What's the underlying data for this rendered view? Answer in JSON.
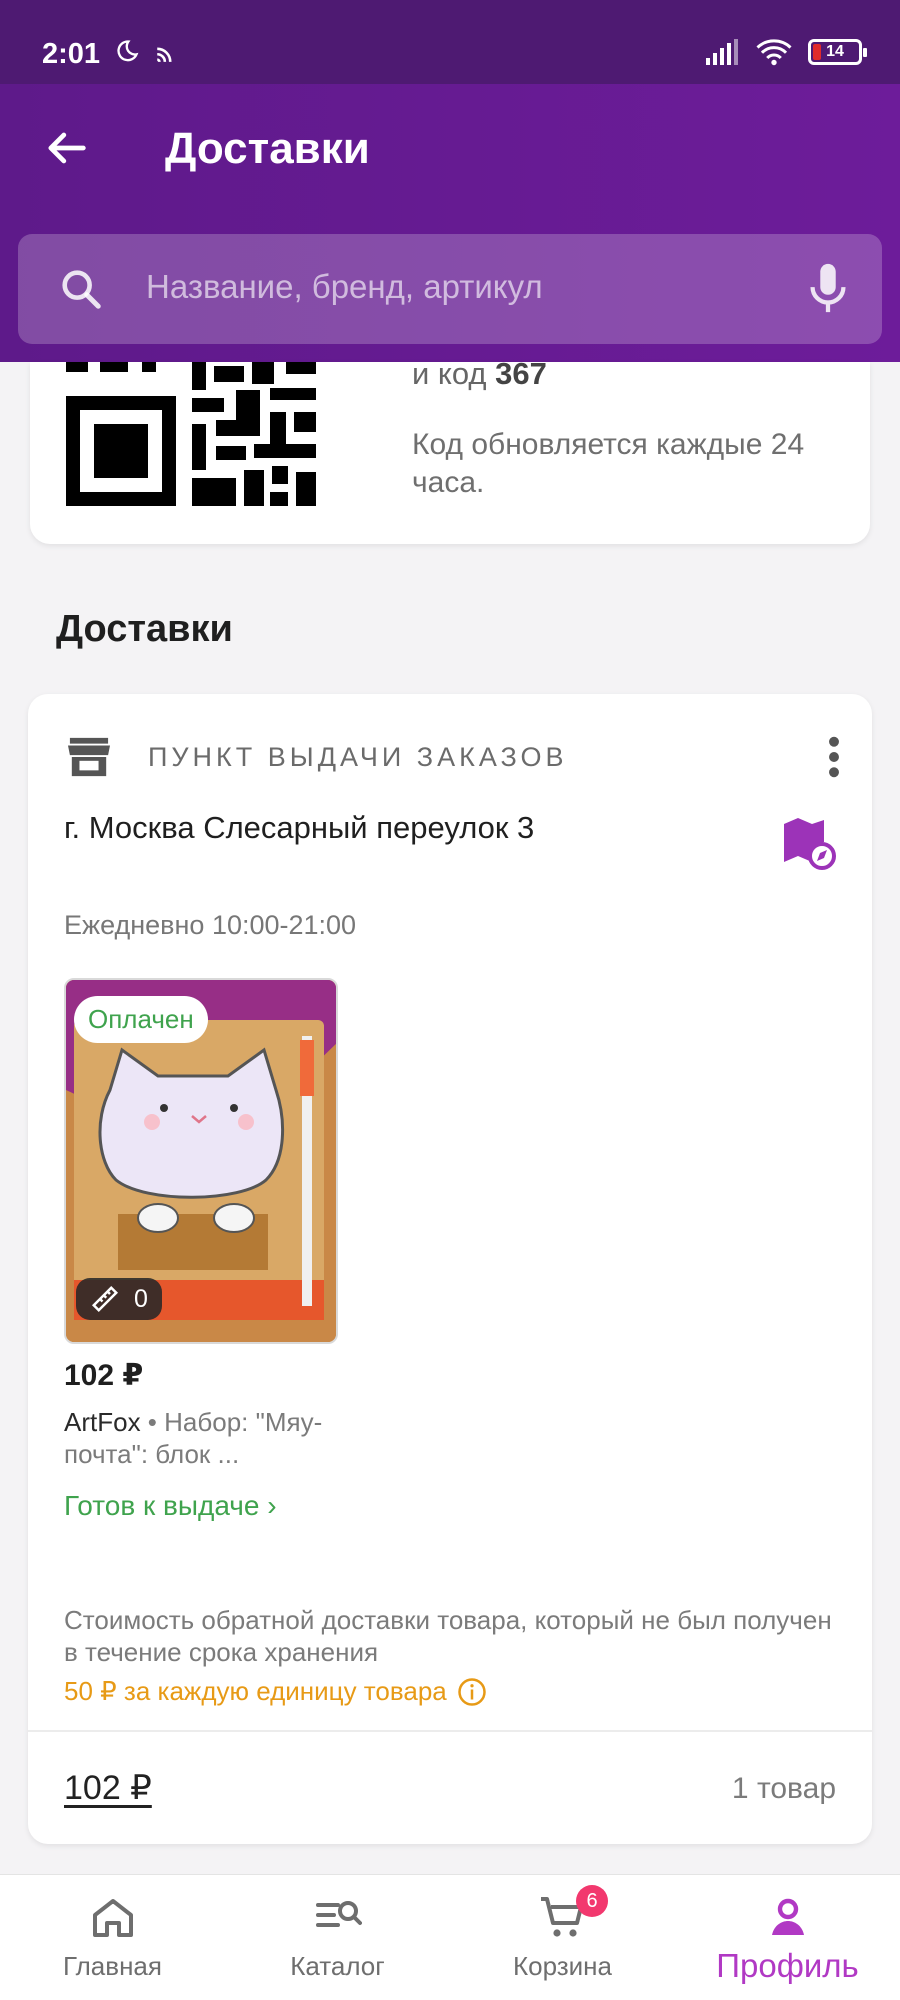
{
  "status_bar": {
    "time": "2:01",
    "battery": "14"
  },
  "header": {
    "title": "Доставки",
    "search_placeholder": "Название, бренд, артикул"
  },
  "qr_card": {
    "code_prefix": "и код",
    "code": "367",
    "refresh_note": "Код обновляется каждые 24 часа."
  },
  "section": {
    "title": "Доставки"
  },
  "delivery": {
    "pickup_label": "ПУНКТ ВЫДАЧИ ЗАКАЗОВ",
    "address": "г. Москва Слесарный переулок 3",
    "hours": "Ежедневно 10:00-21:00",
    "product": {
      "paid_badge": "Оплачен",
      "size_count": "0",
      "price": "102 ₽",
      "brand": "ArtFox",
      "name": " • Набор: \"Мяу-почта\": блок ...",
      "status": "Готов к выдаче ›"
    },
    "return_note": "Стоимость обратной доставки товара, который не был получен в течение срока хранения",
    "return_fee": "50 ₽ за каждую единицу товара",
    "total": "102 ₽",
    "items_count": "1 товар"
  },
  "bottom_nav": {
    "items": [
      {
        "label": "Главная",
        "icon": "home-icon"
      },
      {
        "label": "Каталог",
        "icon": "catalog-search-icon"
      },
      {
        "label": "Корзина",
        "icon": "cart-icon",
        "badge": "6"
      },
      {
        "label": "Профиль",
        "icon": "profile-icon",
        "active": true
      }
    ]
  },
  "colors": {
    "brand_purple": "#6d1c9a",
    "status_green": "#3fa34d",
    "fee_orange": "#e79a16",
    "active_nav": "#b139c4",
    "badge_pink": "#f2386e"
  }
}
